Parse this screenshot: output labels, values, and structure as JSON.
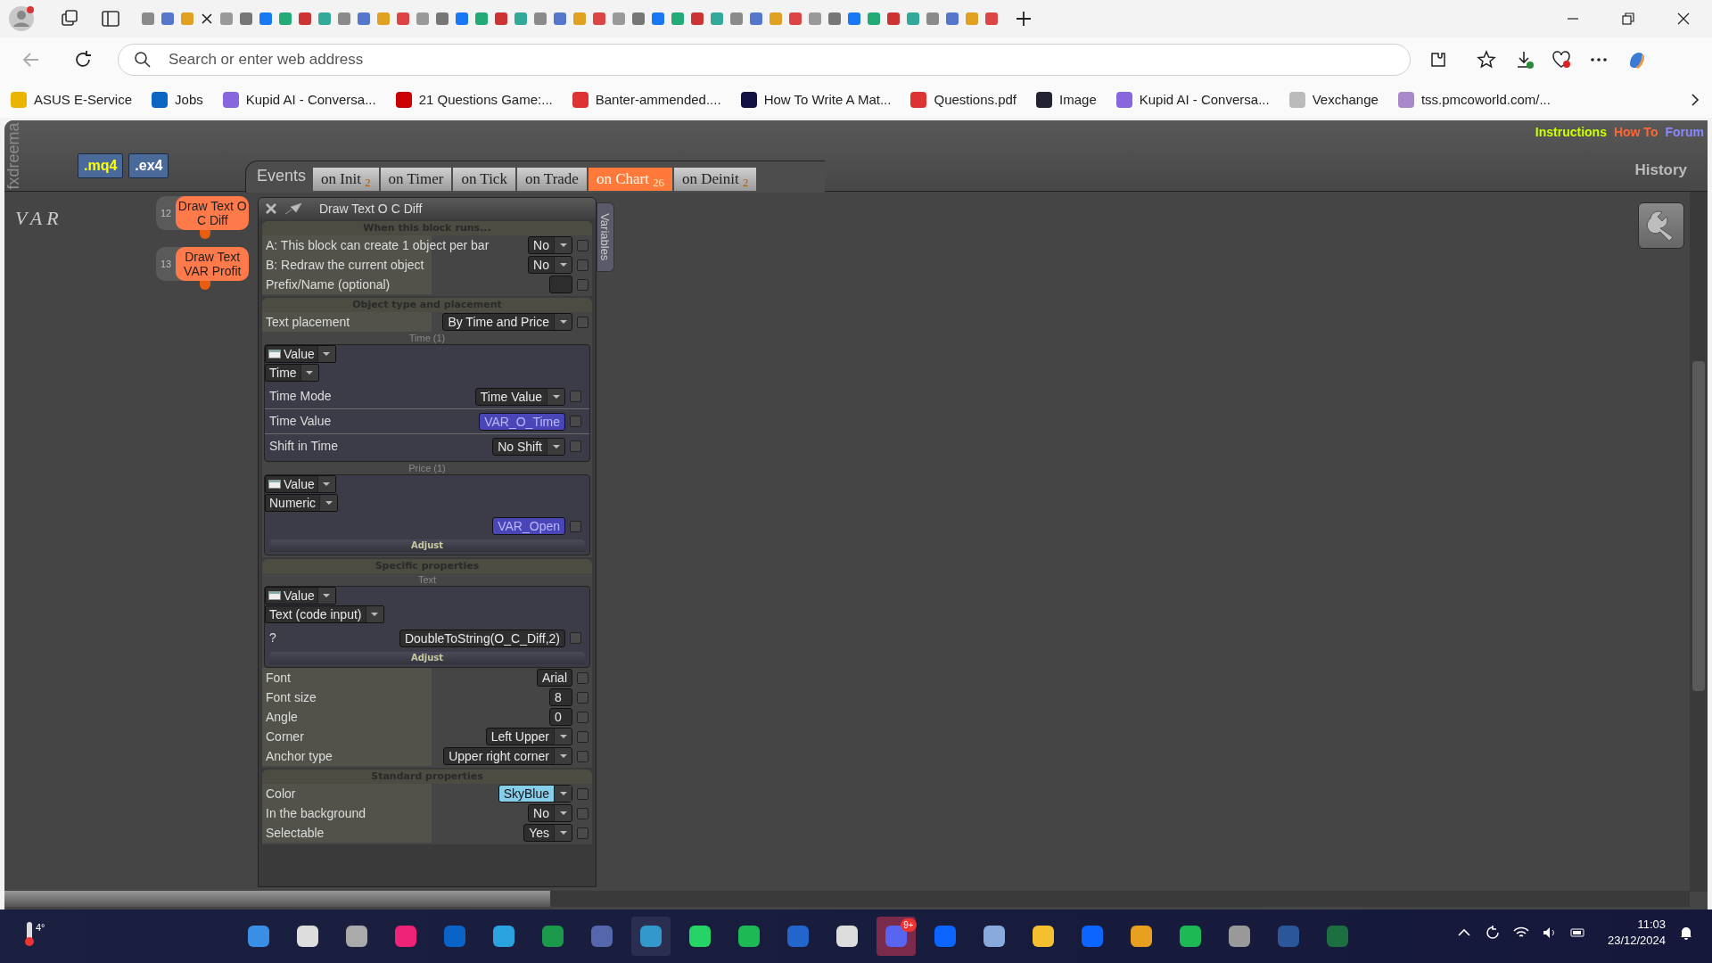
{
  "browser": {
    "address_placeholder": "Search or enter web address",
    "bookmarks": [
      "ASUS E-Service",
      "Jobs",
      "Kupid AI - Conversa...",
      "21 Questions Game:...",
      "Banter-ammended....",
      "How To Write A Mat...",
      "Questions.pdf",
      "Image",
      "Kupid AI - Conversa...",
      "Vexchange",
      "tss.pmcoworld.com/..."
    ]
  },
  "app": {
    "logo": "fxdreema",
    "export_buttons": [
      ".mq4",
      ".ex4"
    ],
    "links": [
      {
        "label": "Instructions",
        "color": "#ccff00"
      },
      {
        "label": "How To",
        "color": "#ff6633"
      },
      {
        "label": "Forum",
        "color": "#8888ff"
      }
    ],
    "events_label": "Events",
    "tabs": [
      {
        "label": "on Init $_{2}$",
        "selected": false
      },
      {
        "label": "on Timer",
        "selected": false
      },
      {
        "label": "on Tick",
        "selected": false
      },
      {
        "label": "on Trade",
        "selected": false
      },
      {
        "label": "on Chart $_{26}$",
        "selected": true
      },
      {
        "label": "on Deinit $_{2}$",
        "selected": false
      }
    ],
    "history": "History",
    "var_label": "VAR",
    "blocks": [
      {
        "number": "12",
        "title": "Draw Text O C Diff"
      },
      {
        "number": "13",
        "title": "Draw Text VAR Profit"
      }
    ],
    "panel": {
      "title": "Draw Text O C Diff",
      "side_tab": "Variables",
      "sections": [
        {
          "heading": "When this block runs...",
          "items": [
            {
              "kind": "dropdown",
              "label": "A: This block can create 1 object per bar",
              "value": "No",
              "checked": false
            },
            {
              "kind": "dropdown",
              "label": "B: Redraw the current object",
              "value": "No",
              "checked": false
            },
            {
              "kind": "field",
              "label": "Prefix/Name (optional)",
              "checked": false
            }
          ]
        },
        {
          "heading": "Object type and placement",
          "items": [
            {
              "kind": "dropdown",
              "label": "Text placement",
              "value": "By Time and Price",
              "checked": false
            },
            {
              "kind": "group",
              "caption": "Time (1)",
              "source": "Value",
              "type": "Time",
              "rows": [
                {
                  "kind": "dropdown",
                  "label": "Time Mode",
                  "value": "Time Value",
                  "checked": false
                },
                {
                  "kind": "variable",
                  "label": "Time Value",
                  "value": "VAR_O_Time",
                  "checked": false
                },
                {
                  "kind": "dropdown",
                  "label": "Shift in Time",
                  "value": "No Shift",
                  "checked": false
                }
              ]
            },
            {
              "kind": "group",
              "caption": "Price (1)",
              "source": "Value",
              "type": "Numeric",
              "rows": [
                {
                  "kind": "variable",
                  "value": "VAR_Open",
                  "checked": false
                }
              ],
              "adjust": "Adjust"
            }
          ]
        },
        {
          "heading": "Specific properties",
          "items": [
            {
              "kind": "group",
              "caption": "Text",
              "source": "Value",
              "type": "Text (code input)",
              "rows": [
                {
                  "kind": "field",
                  "label": "?",
                  "value": "DoubleToString(O_C_Diff,2)",
                  "checked": false
                }
              ],
              "adjust": "Adjust"
            },
            {
              "kind": "field",
              "label": "Font",
              "value": "Arial",
              "checked": false
            },
            {
              "kind": "field",
              "label": "Font size",
              "value": "8",
              "checked": false
            },
            {
              "kind": "field",
              "label": "Angle",
              "value": "0",
              "checked": false
            },
            {
              "kind": "dropdown",
              "label": "Corner",
              "value": "Left Upper",
              "checked": false
            },
            {
              "kind": "dropdown",
              "label": "Anchor type",
              "value": "Upper right corner",
              "checked": false
            }
          ]
        },
        {
          "heading": "Standard properties",
          "items": [
            {
              "kind": "swatch",
              "label": "Color",
              "value": "SkyBlue",
              "checked": false
            },
            {
              "kind": "dropdown",
              "label": "In the background",
              "value": "No",
              "checked": false
            },
            {
              "kind": "dropdown",
              "label": "Selectable",
              "value": "Yes",
              "checked": false
            }
          ]
        }
      ]
    }
  },
  "taskbar": {
    "temperature": "4°",
    "badge": "9+",
    "time": "11:03",
    "date": "23/12/2024"
  }
}
